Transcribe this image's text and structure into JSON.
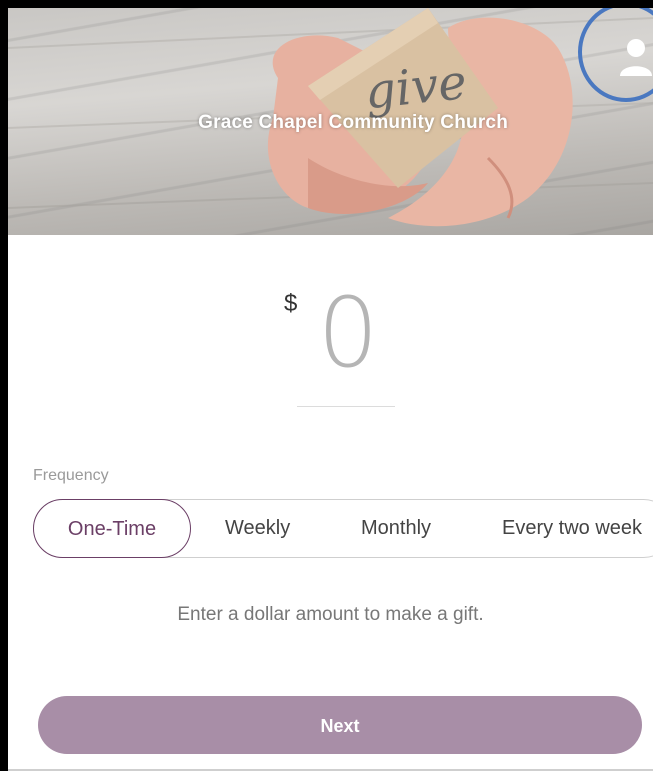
{
  "header": {
    "church_name": "Grace Chapel Community Church",
    "hero_word": "give",
    "profile_icon": "user-icon"
  },
  "amount": {
    "currency_symbol": "$",
    "value": "0"
  },
  "frequency": {
    "label": "Frequency",
    "options": [
      "One-Time",
      "Weekly",
      "Monthly",
      "Every two week"
    ],
    "selected": "One-Time"
  },
  "helper_text": "Enter a dollar amount to make a gift.",
  "next_button": "Next",
  "colors": {
    "accent": "#6b3f66",
    "button": "#a88ea7",
    "highlight_ring": "#4a78c0"
  }
}
